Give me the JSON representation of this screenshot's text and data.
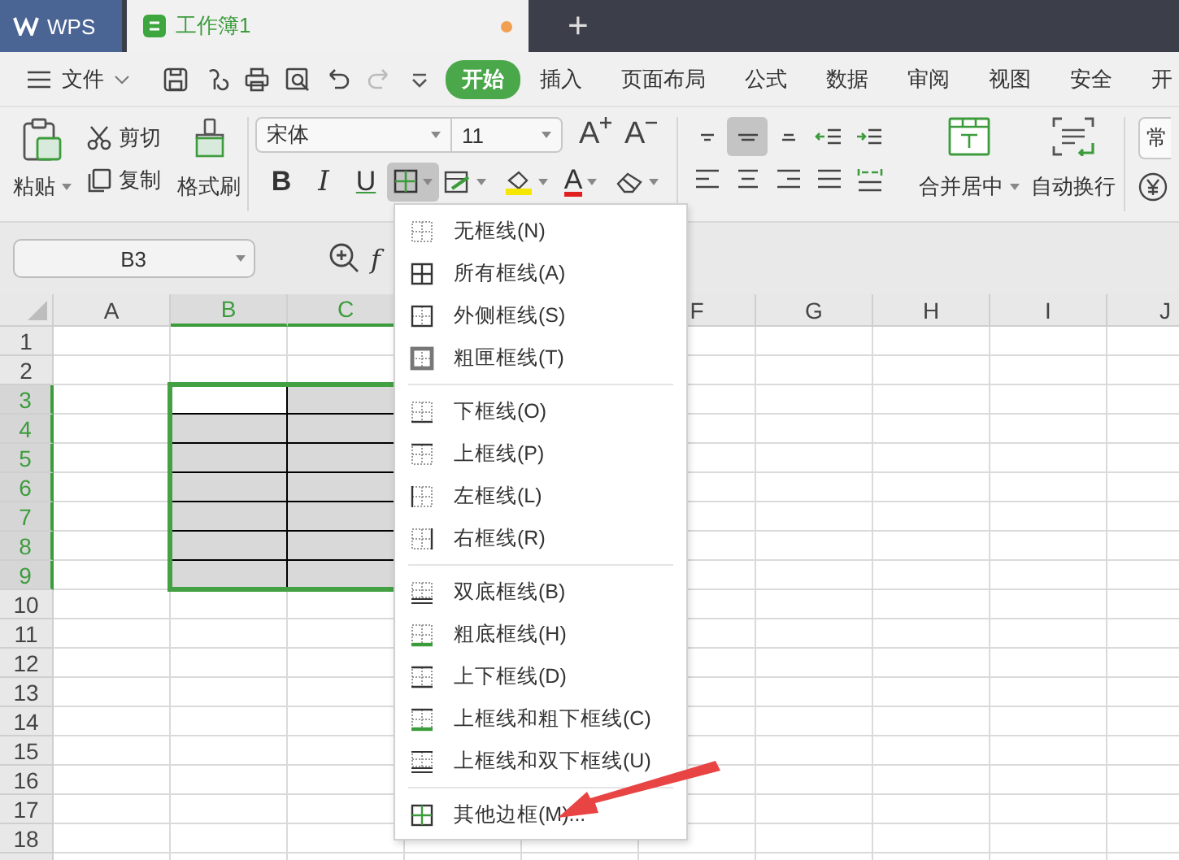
{
  "title_bar": {
    "app_tab": "WPS",
    "doc_tab": {
      "label": "工作簿1",
      "modified": true
    },
    "new_tab": "+"
  },
  "menu_bar": {
    "file_menu": "文件",
    "tabs": [
      {
        "label": "开始",
        "selected": true
      },
      {
        "label": "插入",
        "selected": false
      },
      {
        "label": "页面布局",
        "selected": false
      },
      {
        "label": "公式",
        "selected": false
      },
      {
        "label": "数据",
        "selected": false
      },
      {
        "label": "审阅",
        "selected": false
      },
      {
        "label": "视图",
        "selected": false
      },
      {
        "label": "安全",
        "selected": false
      },
      {
        "label": "开",
        "selected": false
      }
    ]
  },
  "ribbon": {
    "paste": "粘贴",
    "cut": "剪切",
    "copy": "复制",
    "format_painter": "格式刷",
    "font_name": "宋体",
    "font_size": "11",
    "grow_font": "A",
    "shrink_font": "A",
    "bold": "B",
    "italic": "I",
    "underline": "U",
    "font_color": "A",
    "border_button": {
      "open": true
    },
    "align_buttons": [
      {
        "kind": "top",
        "selected": false
      },
      {
        "kind": "middle",
        "selected": true
      },
      {
        "kind": "bottom",
        "selected": false
      },
      {
        "kind": "outdent",
        "selected": false
      },
      {
        "kind": "indent",
        "selected": false
      },
      {
        "kind": "left",
        "selected": false
      },
      {
        "kind": "center",
        "selected": false
      },
      {
        "kind": "right",
        "selected": false
      },
      {
        "kind": "justify",
        "selected": false
      },
      {
        "kind": "distributed",
        "selected": false
      }
    ],
    "merge": "合并居中",
    "wrap": "自动换行",
    "number_format": "常"
  },
  "formula_bar": {
    "cell_ref": "B3",
    "function_label": "f"
  },
  "sheet": {
    "columns": [
      {
        "label": "A",
        "selected": false
      },
      {
        "label": "B",
        "selected": true,
        "active": true
      },
      {
        "label": "C",
        "selected": true,
        "active": false
      },
      {
        "selected": false
      },
      {
        "selected": false
      },
      {
        "label": "F",
        "selected": false
      },
      {
        "label": "G",
        "selected": false
      },
      {
        "label": "H",
        "selected": false
      },
      {
        "label": "I",
        "selected": false
      },
      {
        "label": "J",
        "selected": false
      }
    ],
    "rows": [
      {
        "label": "1",
        "selected": false
      },
      {
        "label": "2",
        "selected": false
      },
      {
        "label": "3",
        "selected": true,
        "active": true
      },
      {
        "label": "4",
        "selected": true,
        "active": false
      },
      {
        "label": "5",
        "selected": true,
        "active": false
      },
      {
        "label": "6",
        "selected": true,
        "active": false
      },
      {
        "label": "7",
        "selected": true,
        "active": false
      },
      {
        "label": "8",
        "selected": true,
        "active": false
      },
      {
        "label": "9",
        "selected": true,
        "active": false
      },
      {
        "label": "10",
        "selected": false
      },
      {
        "label": "11",
        "selected": false
      },
      {
        "label": "12",
        "selected": false
      },
      {
        "label": "13",
        "selected": false
      },
      {
        "label": "14",
        "selected": false
      },
      {
        "label": "15",
        "selected": false
      },
      {
        "label": "16",
        "selected": false
      },
      {
        "label": "17",
        "selected": false
      },
      {
        "label": "18",
        "selected": false
      }
    ]
  },
  "border_menu": {
    "groups": [
      [
        {
          "label": "无框线(N)",
          "kind": "none"
        },
        {
          "label": "所有框线(A)",
          "kind": "all"
        },
        {
          "label": "外侧框线(S)",
          "kind": "outside"
        },
        {
          "label": "粗匣框线(T)",
          "kind": "thick_box"
        }
      ],
      [
        {
          "label": "下框线(O)",
          "kind": "bottom"
        },
        {
          "label": "上框线(P)",
          "kind": "top"
        },
        {
          "label": "左框线(L)",
          "kind": "left"
        },
        {
          "label": "右框线(R)",
          "kind": "right"
        }
      ],
      [
        {
          "label": "双底框线(B)",
          "kind": "double_bottom"
        },
        {
          "label": "粗底框线(H)",
          "kind": "thick_bottom"
        },
        {
          "label": "上下框线(D)",
          "kind": "top_bottom"
        },
        {
          "label": "上框线和粗下框线(C)",
          "kind": "top_thick_bottom"
        },
        {
          "label": "上框线和双下框线(U)",
          "kind": "top_double_bottom"
        }
      ],
      [
        {
          "label": "其他边框(M)...",
          "kind": "more"
        }
      ]
    ]
  }
}
